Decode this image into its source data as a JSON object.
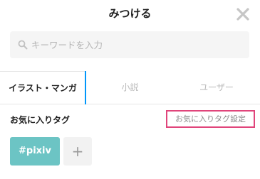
{
  "header": {
    "title": "みつける",
    "close_icon": "close-icon"
  },
  "search": {
    "placeholder": "キーワードを入力",
    "value": "",
    "icon": "search-icon"
  },
  "tabs": [
    {
      "label": "イラスト・マンガ",
      "active": true
    },
    {
      "label": "小説",
      "active": false
    },
    {
      "label": "ユーザー",
      "active": false
    }
  ],
  "favorite_tags": {
    "label": "お気に入りタグ",
    "settings_link": "お気に入りタグ設定",
    "tags": [
      {
        "label": "#pixiv"
      }
    ],
    "add_label": "+"
  },
  "colors": {
    "active_tab_accent": "#0096fa",
    "highlight_border": "#e0457b",
    "tag_background": "#6cc4c4"
  }
}
